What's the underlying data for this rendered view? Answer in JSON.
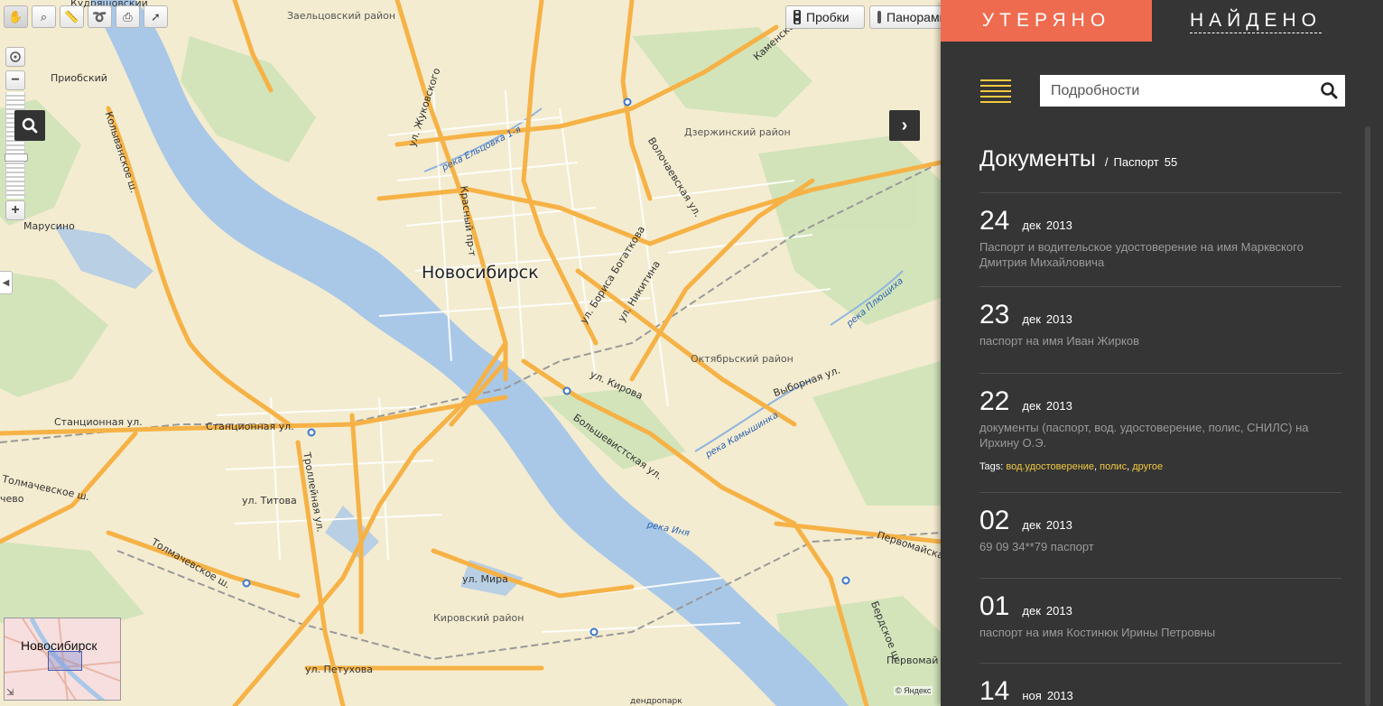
{
  "map": {
    "toolbar": [
      {
        "name": "drag-tool",
        "glyph": "✋",
        "active": true
      },
      {
        "name": "magnifier-tool",
        "glyph": "⌕",
        "active": false
      },
      {
        "name": "ruler-tool",
        "glyph": "📏",
        "active": false
      },
      {
        "name": "route-tool",
        "glyph": "➰",
        "active": false
      },
      {
        "name": "print-tool",
        "glyph": "⎙",
        "active": false
      },
      {
        "name": "cursor-tool",
        "glyph": "➚",
        "active": false
      }
    ],
    "traffic_label": "Пробки",
    "panorama_label": "Панорамы",
    "city_label": "Новосибирск",
    "labels": {
      "kudryashovsky": "Кудряшовский",
      "zaeltsovsky": "Заельцовский район",
      "kamenskoe": "Каменское ш.",
      "priobsky": "Приобский",
      "kolyvanskoe": "Колыванское ш.",
      "zhukovskogo": "ул. Жуковского",
      "elcovka": "река Ельцовка 1-я",
      "dzerzhinsky": "Дзержинский район",
      "volochaevskaya": "Волочаевская ул.",
      "marusino": "Марусино",
      "krasny": "Красный пр-т",
      "bogatkova": "ул. Бориса Богаткова",
      "nikitina": "ул. Никитина",
      "plyuschikha": "река Плющиха",
      "oktyabrsky": "Октябрьский район",
      "kirova": "ул. Кирова",
      "vybornaya": "Выборная ул.",
      "kamyshinka": "река Камышинка",
      "stantsionnaya1": "Станционная ул.",
      "stantsionnaya2": "Станционная ул.",
      "bolshevistskaya": "Большевистская ул.",
      "tolmachevskoe1": "Толмачевское ш.",
      "tolmachevskoe2": "Толмачевское ш.",
      "trolleinaya": "Троллейная ул.",
      "titova": "ул. Титова",
      "chevo": "чево",
      "inya": "река Иня",
      "pervomayskaya": "Первомайская",
      "mira": "ул. Мира",
      "kirovsky": "Кировский район",
      "berdskoe": "Бердское ш.",
      "petukhova": "ул. Петухова",
      "pervomay": "Первомай",
      "dendropark": "дендропарк"
    },
    "minimap_label": "Новосибирск",
    "copyright": "© Яндекс"
  },
  "panel": {
    "tab_lost": "УТЕРЯНО",
    "tab_found": "НАЙДЕНО",
    "search_placeholder": "Подробности",
    "breadcrumb_title": "Документы",
    "breadcrumb_sep": "/",
    "breadcrumb_sub": "Паспорт",
    "breadcrumb_count": "55",
    "accent_color": "#ef6b4f",
    "tag_color": "#f0c940",
    "entries": [
      {
        "day": "24",
        "month": "дек",
        "year": "2013",
        "desc": "Паспорт и водительское удостоверение на имя Марквского Дмитрия Михайловича"
      },
      {
        "day": "23",
        "month": "дек",
        "year": "2013",
        "desc": "паспорт на имя Иван Жирков"
      },
      {
        "day": "22",
        "month": "дек",
        "year": "2013",
        "desc": "документы (паспорт, вод. удостоверение, полис, СНИЛС) на Ирхину О.Э.",
        "tags_label": "Tags:",
        "tags": [
          "вод.удостоверение",
          "полис",
          "другое"
        ]
      },
      {
        "day": "02",
        "month": "дек",
        "year": "2013",
        "desc": "69 09 34**79 паспорт"
      },
      {
        "day": "01",
        "month": "дек",
        "year": "2013",
        "desc": "паспорт на имя Костинюк Ирины Петровны"
      },
      {
        "day": "14",
        "month": "ноя",
        "year": "2013",
        "desc": ""
      }
    ]
  }
}
